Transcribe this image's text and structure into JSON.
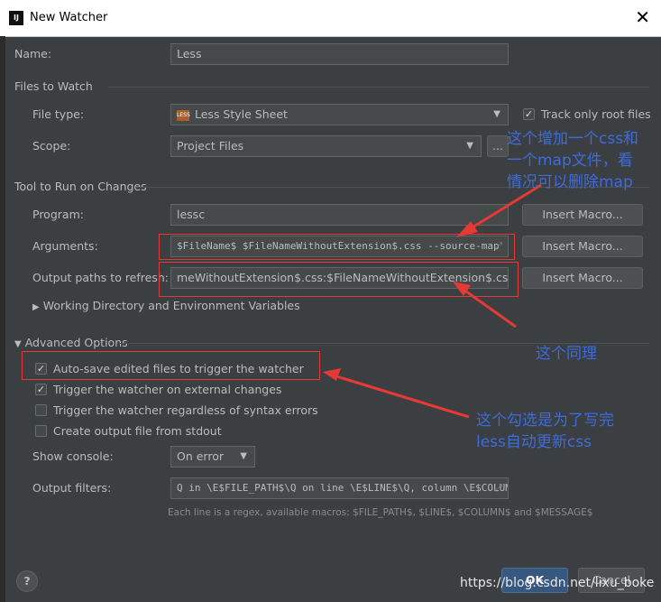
{
  "window": {
    "title": "New Watcher",
    "icon": "IJ"
  },
  "name": {
    "label": "Name:",
    "value": "Less"
  },
  "files_to_watch": {
    "section": "Files to Watch",
    "file_type_label": "File type:",
    "file_type_value": "Less Style Sheet",
    "file_type_icon": "LESS",
    "track_root_label": "Track only root files",
    "scope_label": "Scope:",
    "scope_value": "Project Files",
    "scope_more": "..."
  },
  "tool": {
    "section": "Tool to Run on Changes",
    "program_label": "Program:",
    "program_value": "lessc",
    "arguments_label": "Arguments:",
    "arguments_value": "$FileName$ $FileNameWithoutExtension$.css --source-map",
    "output_label": "Output paths to refresh:",
    "output_value": "meWithoutExtension$.css:$FileNameWithoutExtension$.css.map",
    "insert_macro": "Insert Macro...",
    "working_dir": "Working Directory and Environment Variables"
  },
  "advanced": {
    "section": "Advanced Options",
    "autosave": "Auto-save edited files to trigger the watcher",
    "external": "Trigger the watcher on external changes",
    "regardless": "Trigger the watcher regardless of syntax errors",
    "stdout": "Create output file from stdout",
    "console_label": "Show console:",
    "console_value": "On error",
    "filters_label": "Output filters:",
    "filters_value": "Q in \\E$FILE_PATH$\\Q on line \\E$LINE$\\Q, column \\E$COLUMN$",
    "hint": "Each line is a regex, available macros: $FILE_PATH$, $LINE$, $COLUMN$ and $MESSAGE$"
  },
  "footer": {
    "help": "?",
    "ok": "OK",
    "cancel": "Cancel"
  },
  "annotations": {
    "note1_line1": "这个增加一个css和",
    "note1_line2": "一个map文件，看",
    "note1_line3": "情况可以删除map",
    "note2": "这个同理",
    "note3_line1": "这个勾选是为了写完",
    "note3_line2": "less自动更新css",
    "watermark": "https://blog.csdn.net/lixu_boke"
  },
  "colors": {
    "background": "#3c3f41",
    "annotation": "#3d6bd9",
    "highlight": "#e53935"
  }
}
